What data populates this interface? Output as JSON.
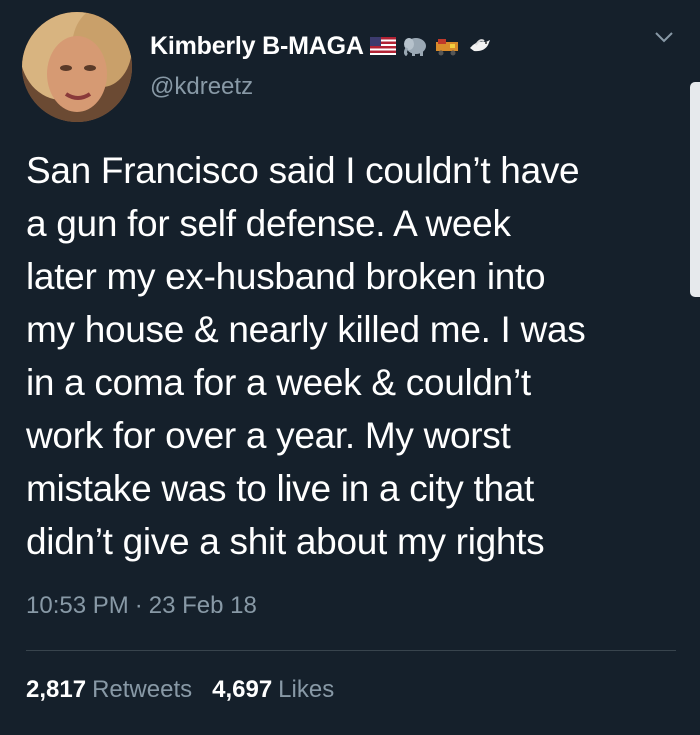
{
  "tweet": {
    "author": {
      "display_name": "Kimberly B-MAGA",
      "handle": "@kdreetz",
      "name_emojis": [
        "flag-usa-icon",
        "elephant-icon",
        "train-icon",
        "dove-icon"
      ]
    },
    "text": "San Francisco said I couldn’t have\na gun for self defense. A week\nlater my ex-husband broken into\nmy house & nearly killed me. I was\nin a coma for a week & couldn’t\nwork for over a year.  My worst\nmistake was to live in a city that\ndidn’t give a shit about my rights",
    "time": "10:53 PM",
    "separator": "·",
    "date": "23 Feb 18",
    "stats": {
      "retweets_count": "2,817",
      "retweets_label": "Retweets",
      "likes_count": "4,697",
      "likes_label": "Likes"
    }
  },
  "colors": {
    "background": "#15202b",
    "text": "#ffffff",
    "secondary": "#8899a6",
    "divider": "#38444d"
  }
}
